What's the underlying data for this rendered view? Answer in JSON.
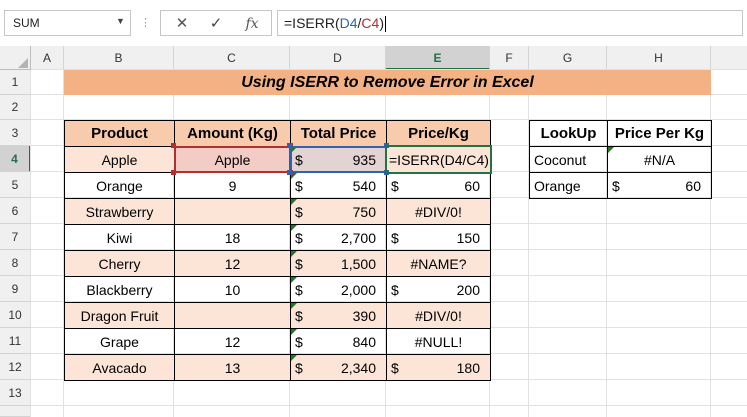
{
  "formula_bar": {
    "name_box": "SUM",
    "cancel_icon": "✕",
    "enter_icon": "✓",
    "fx_label": "fx",
    "formula_prefix": "=ISERR(",
    "formula_ref1": "D4",
    "formula_sep": "/",
    "formula_ref2": "C4",
    "formula_suffix": ")"
  },
  "columns": [
    "A",
    "B",
    "C",
    "D",
    "E",
    "F",
    "G",
    "H"
  ],
  "rows": [
    "1",
    "2",
    "3",
    "4",
    "5",
    "6",
    "7",
    "8",
    "9",
    "10",
    "11",
    "12",
    "13"
  ],
  "title": "Using ISERR to Remove Error in Excel",
  "main_table": {
    "headers": [
      "Product",
      "Amount (Kg)",
      "Total Price",
      "Price/Kg"
    ],
    "rows": [
      {
        "product": "Apple",
        "amount": "Apple",
        "total_cur": "$",
        "total": "935",
        "pkg_cur": "",
        "pkg": "=ISERR(D4/C4)"
      },
      {
        "product": "Orange",
        "amount": "9",
        "total_cur": "$",
        "total": "540",
        "pkg_cur": "$",
        "pkg": "60"
      },
      {
        "product": "Strawberry",
        "amount": "",
        "total_cur": "$",
        "total": "750",
        "pkg_cur": "",
        "pkg": "#DIV/0!"
      },
      {
        "product": "Kiwi",
        "amount": "18",
        "total_cur": "$",
        "total": "2,700",
        "pkg_cur": "$",
        "pkg": "150"
      },
      {
        "product": "Cherry",
        "amount": "12",
        "total_cur": "$",
        "total": "1,500",
        "pkg_cur": "",
        "pkg": "#NAME?"
      },
      {
        "product": "Blackberry",
        "amount": "10",
        "total_cur": "$",
        "total": "2,000",
        "pkg_cur": "$",
        "pkg": "200"
      },
      {
        "product": "Dragon Fruit",
        "amount": "",
        "total_cur": "$",
        "total": "390",
        "pkg_cur": "",
        "pkg": "#DIV/0!"
      },
      {
        "product": "Grape",
        "amount": "12",
        "total_cur": "$",
        "total": "840",
        "pkg_cur": "",
        "pkg": "#NULL!"
      },
      {
        "product": "Avacado",
        "amount": "13",
        "total_cur": "$",
        "total": "2,340",
        "pkg_cur": "$",
        "pkg": "180"
      }
    ]
  },
  "lookup_table": {
    "headers": [
      "LookUp",
      "Price Per Kg"
    ],
    "rows": [
      {
        "item": "Coconut",
        "cur": "",
        "value": "#N/A"
      },
      {
        "item": "Orange",
        "cur": "$",
        "value": "60"
      }
    ]
  },
  "colors": {
    "title_fill": "#f4b183",
    "header_fill": "#f8cbad",
    "band_fill": "#fce4d6",
    "excel_green": "#217346",
    "ref_blue": "#2f63b0",
    "ref_red": "#b02f2f"
  }
}
